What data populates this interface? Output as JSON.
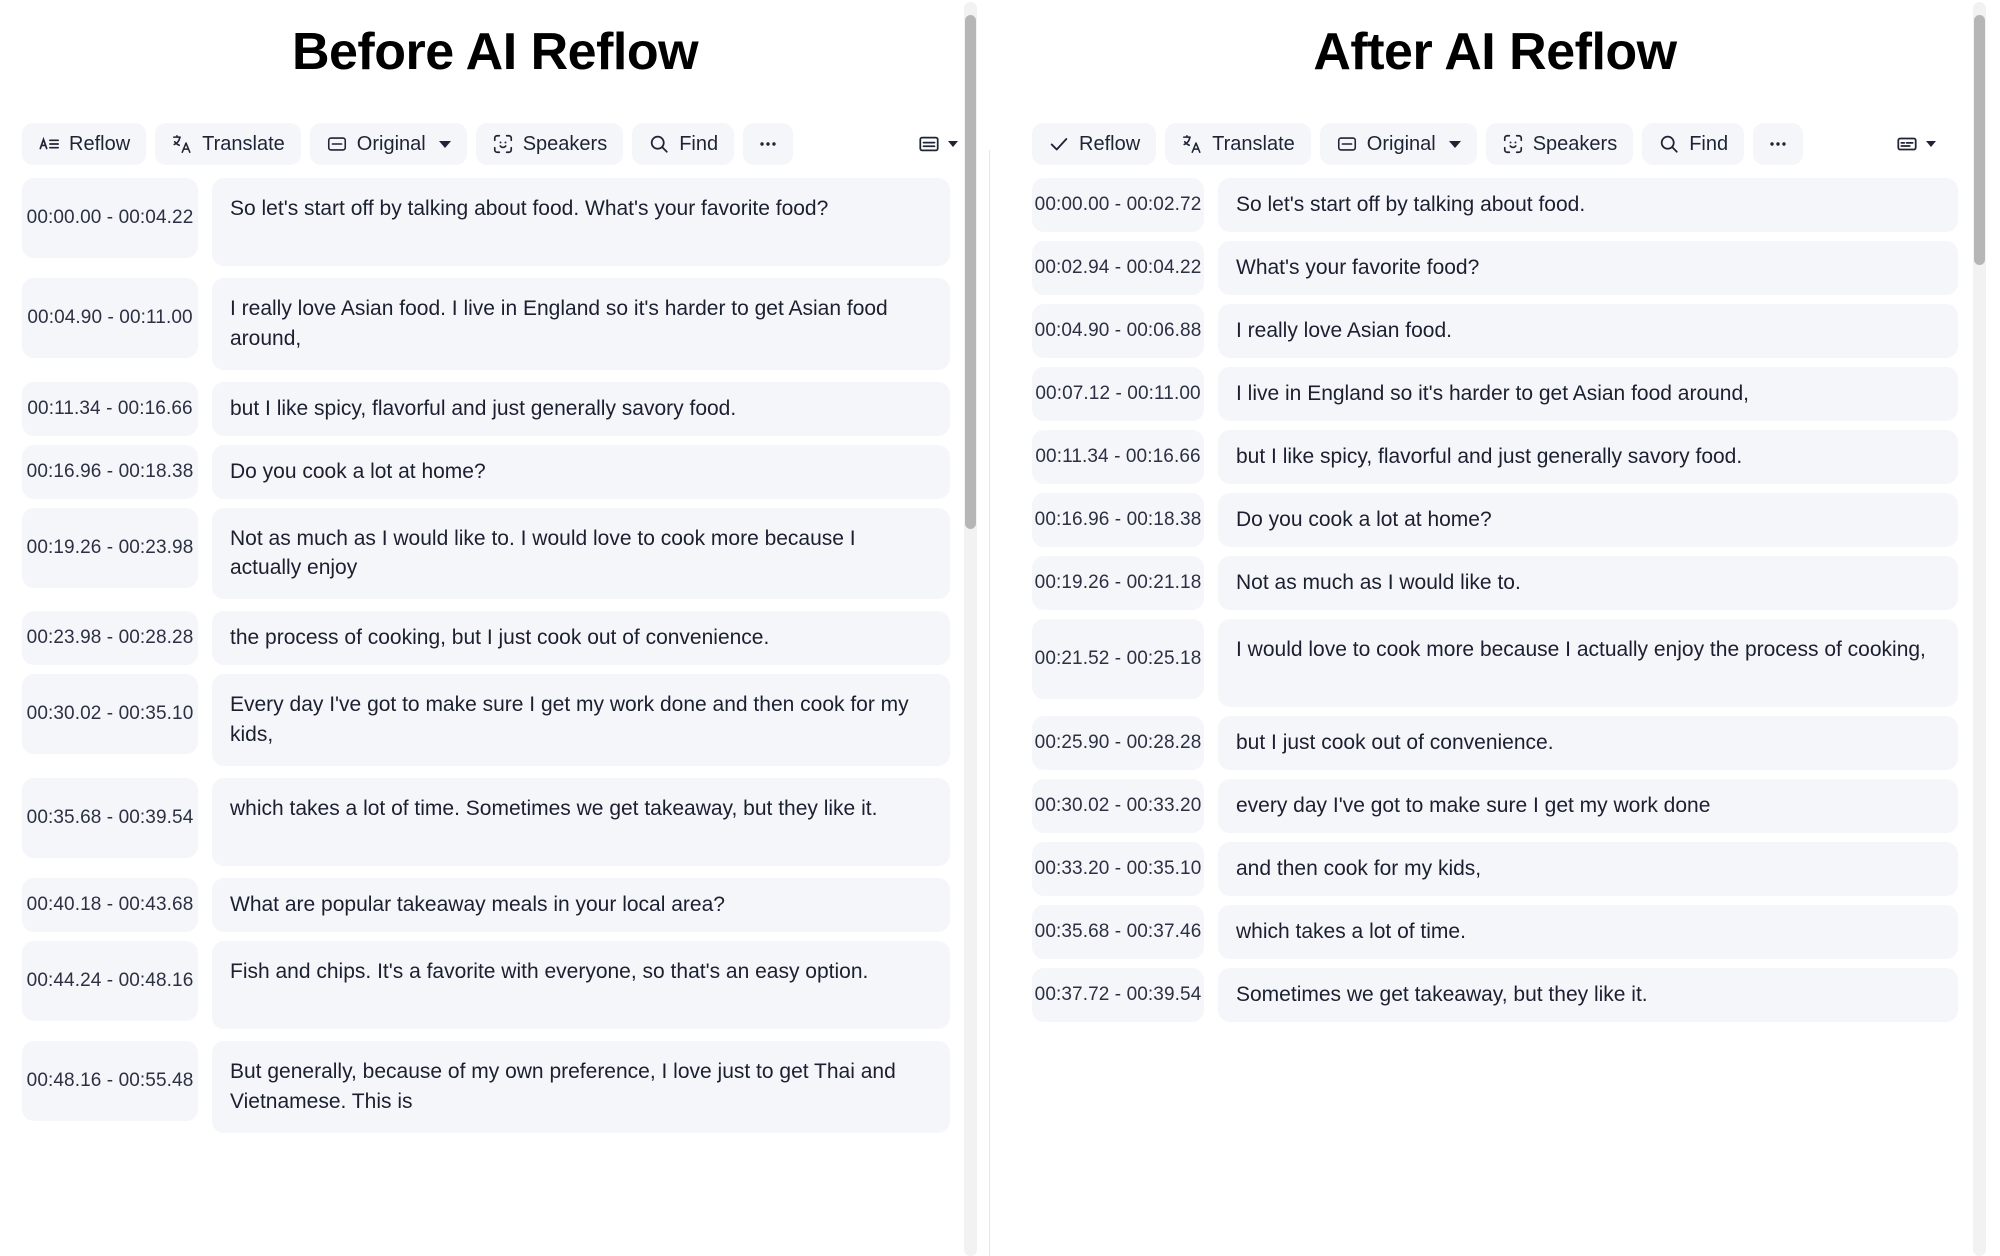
{
  "panels": [
    {
      "title": "Before AI Reflow",
      "toolbar": {
        "buttons": [
          {
            "label": "Reflow",
            "icon": "text-reflow-icon",
            "caret": false
          },
          {
            "label": "Translate",
            "icon": "translate-icon",
            "caret": false
          },
          {
            "label": "Original",
            "icon": "captions-box-icon",
            "caret": true
          },
          {
            "label": "Speakers",
            "icon": "speaker-face-icon",
            "caret": false
          },
          {
            "label": "Find",
            "icon": "search-icon",
            "caret": false
          },
          {
            "label": "",
            "icon": "more-horizontal-icon",
            "caret": false
          }
        ],
        "view_icon": "layout-view-icon",
        "view_caret": true
      },
      "rows": [
        {
          "time": "00:00.00 - 00:04.22",
          "text": "So let's start off by talking about food. What's your favorite food?",
          "lines": 2
        },
        {
          "time": "00:04.90 - 00:11.00",
          "text": "I really love Asian food. I live in England so it's harder to get Asian food around,",
          "lines": 2
        },
        {
          "time": "00:11.34 - 00:16.66",
          "text": "but I like spicy, flavorful and just generally savory food.",
          "lines": 1
        },
        {
          "time": "00:16.96 - 00:18.38",
          "text": "Do you cook a lot at home?",
          "lines": 1
        },
        {
          "time": "00:19.26 - 00:23.98",
          "text": "Not as much as I would like to. I would love to cook more because I actually enjoy",
          "lines": 2
        },
        {
          "time": "00:23.98 - 00:28.28",
          "text": "the process of cooking, but I just cook out of convenience.",
          "lines": 1
        },
        {
          "time": "00:30.02 - 00:35.10",
          "text": "Every day I've got to make sure I get my work done and then cook for my kids,",
          "lines": 2
        },
        {
          "time": "00:35.68 - 00:39.54",
          "text": "which takes a lot of time. Sometimes we get takeaway, but they like it.",
          "lines": 2
        },
        {
          "time": "00:40.18 - 00:43.68",
          "text": "What are popular takeaway meals in your local area?",
          "lines": 1
        },
        {
          "time": "00:44.24 - 00:48.16",
          "text": "Fish and chips. It's a favorite with everyone, so that's an easy option.",
          "lines": 2
        },
        {
          "time": "00:48.16 - 00:55.48",
          "text": "But generally, because of my own preference, I love just to get Thai and Vietnamese. This is",
          "lines": 2
        }
      ],
      "scroll": {
        "thumb_top_pct": 1,
        "thumb_height_pct": 41
      }
    },
    {
      "title": "After AI Reflow",
      "toolbar": {
        "buttons": [
          {
            "label": "Reflow",
            "icon": "check-icon",
            "caret": false
          },
          {
            "label": "Translate",
            "icon": "translate-icon",
            "caret": false
          },
          {
            "label": "Original",
            "icon": "captions-box-icon",
            "caret": true
          },
          {
            "label": "Speakers",
            "icon": "speaker-face-icon",
            "caret": false
          },
          {
            "label": "Find",
            "icon": "search-icon",
            "caret": false
          },
          {
            "label": "",
            "icon": "more-horizontal-icon",
            "caret": false
          }
        ],
        "view_icon": "layout-view-compact-icon",
        "view_caret": true
      },
      "rows": [
        {
          "time": "00:00.00 - 00:02.72",
          "text": "So let's start off by talking about food.",
          "lines": 1
        },
        {
          "time": "00:02.94 - 00:04.22",
          "text": "What's your favorite food?",
          "lines": 1
        },
        {
          "time": "00:04.90 - 00:06.88",
          "text": "I really love Asian food.",
          "lines": 1
        },
        {
          "time": "00:07.12 - 00:11.00",
          "text": "I live in England so it's harder to get Asian food around,",
          "lines": 1
        },
        {
          "time": "00:11.34 - 00:16.66",
          "text": "but I like spicy, flavorful and just generally savory food.",
          "lines": 1
        },
        {
          "time": "00:16.96 - 00:18.38",
          "text": "Do you cook a lot at home?",
          "lines": 1
        },
        {
          "time": "00:19.26 - 00:21.18",
          "text": "Not as much as I would like to.",
          "lines": 1
        },
        {
          "time": "00:21.52 - 00:25.18",
          "text": "I would love to cook more because I actually enjoy the process of cooking,",
          "lines": 2
        },
        {
          "time": "00:25.90 - 00:28.28",
          "text": "but I just cook out of convenience.",
          "lines": 1
        },
        {
          "time": "00:30.02 - 00:33.20",
          "text": "every day I've got to make sure I get my work done",
          "lines": 1
        },
        {
          "time": "00:33.20 - 00:35.10",
          "text": "and then cook for my kids,",
          "lines": 1
        },
        {
          "time": "00:35.68 - 00:37.46",
          "text": "which takes a lot of time.",
          "lines": 1
        },
        {
          "time": "00:37.72 - 00:39.54",
          "text": "Sometimes we get takeaway, but they like it.",
          "lines": 1
        }
      ],
      "scroll": {
        "thumb_top_pct": 1,
        "thumb_height_pct": 20
      }
    }
  ],
  "colors": {
    "chip_background": "#f5f6fa",
    "text_primary": "#1b2030",
    "title": "#000000",
    "scroll_track": "#f2f2f2",
    "scroll_thumb": "#b6b6b6"
  }
}
